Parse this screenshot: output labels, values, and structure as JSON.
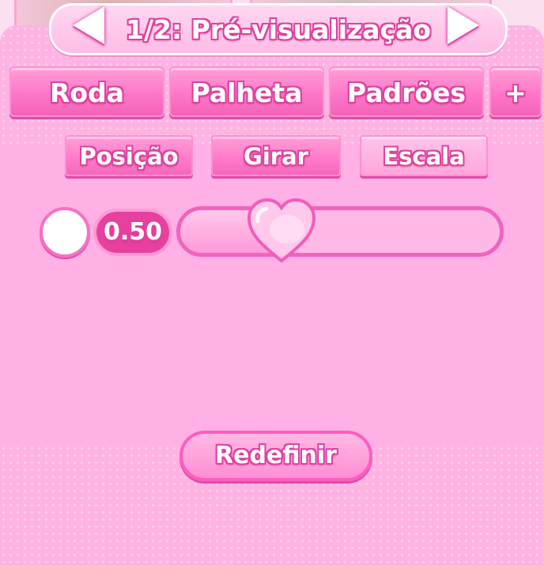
{
  "header": {
    "title": "1/2: Pré-visualização"
  },
  "tabs": [
    {
      "label": "Roda"
    },
    {
      "label": "Palheta"
    },
    {
      "label": "Padrões"
    },
    {
      "label": "+"
    }
  ],
  "subtabs": [
    {
      "label": "Posição"
    },
    {
      "label": "Girar"
    },
    {
      "label": "Escala",
      "selected": true
    }
  ],
  "slider": {
    "value_text": "0.50",
    "value": 0.5,
    "knob_icon": "heart-icon"
  },
  "reset_button": {
    "label": "Redefinir"
  },
  "colors": {
    "accent": "#e0409f",
    "panel": "#ffb3e3",
    "button": "#ff77c8"
  }
}
